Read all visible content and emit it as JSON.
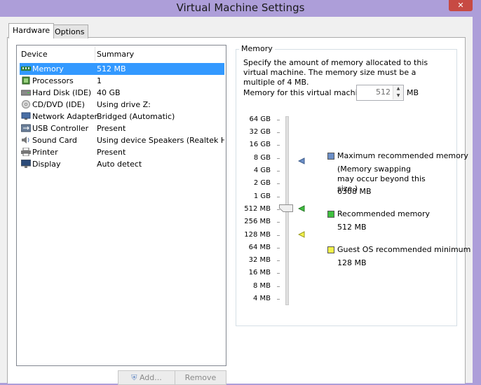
{
  "window": {
    "title": "Virtual Machine Settings"
  },
  "tabs": [
    {
      "label": "Hardware",
      "active": true
    },
    {
      "label": "Options",
      "active": false
    }
  ],
  "device_list": {
    "headers": {
      "device": "Device",
      "summary": "Summary"
    },
    "rows": [
      {
        "device": "Memory",
        "summary": "512 MB",
        "icon": "memory-icon",
        "selected": true
      },
      {
        "device": "Processors",
        "summary": "1",
        "icon": "processor-icon"
      },
      {
        "device": "Hard Disk (IDE)",
        "summary": "40 GB",
        "icon": "hard-disk-icon"
      },
      {
        "device": "CD/DVD (IDE)",
        "summary": "Using drive Z:",
        "icon": "cd-dvd-icon"
      },
      {
        "device": "Network Adapter",
        "summary": "Bridged (Automatic)",
        "icon": "network-adapter-icon"
      },
      {
        "device": "USB Controller",
        "summary": "Present",
        "icon": "usb-icon"
      },
      {
        "device": "Sound Card",
        "summary": "Using device Speakers (Realtek Hi...",
        "icon": "sound-card-icon"
      },
      {
        "device": "Printer",
        "summary": "Present",
        "icon": "printer-icon"
      },
      {
        "device": "Display",
        "summary": "Auto detect",
        "icon": "display-icon"
      }
    ]
  },
  "buttons": {
    "add": "Add...",
    "remove": "Remove"
  },
  "memory": {
    "group_label": "Memory",
    "description": "Specify the amount of memory allocated to this virtual machine. The memory size must be a multiple of 4 MB.",
    "field_label": "Memory for this virtual machine:",
    "value": "512",
    "unit": "MB",
    "scale_labels": [
      "64 GB",
      "32 GB",
      "16 GB",
      "8 GB",
      "4 GB",
      "2 GB",
      "1 GB",
      "512 MB",
      "256 MB",
      "128 MB",
      "64 MB",
      "32 MB",
      "16 MB",
      "8 MB",
      "4 MB"
    ],
    "legend": {
      "max_recommended": {
        "label": "Maximum recommended memory",
        "note": "(Memory swapping may occur beyond this size.)",
        "value": "6308 MB",
        "color": "#6c8fc7"
      },
      "recommended": {
        "label": "Recommended memory",
        "value": "512 MB",
        "color": "#3fbf3f"
      },
      "guest_min": {
        "label": "Guest OS recommended minimum",
        "value": "128 MB",
        "color": "#f2f24a"
      }
    }
  },
  "colors": {
    "selection": "#3399ff",
    "titlebar": "#ad9ed9",
    "close": "#c74a43"
  }
}
